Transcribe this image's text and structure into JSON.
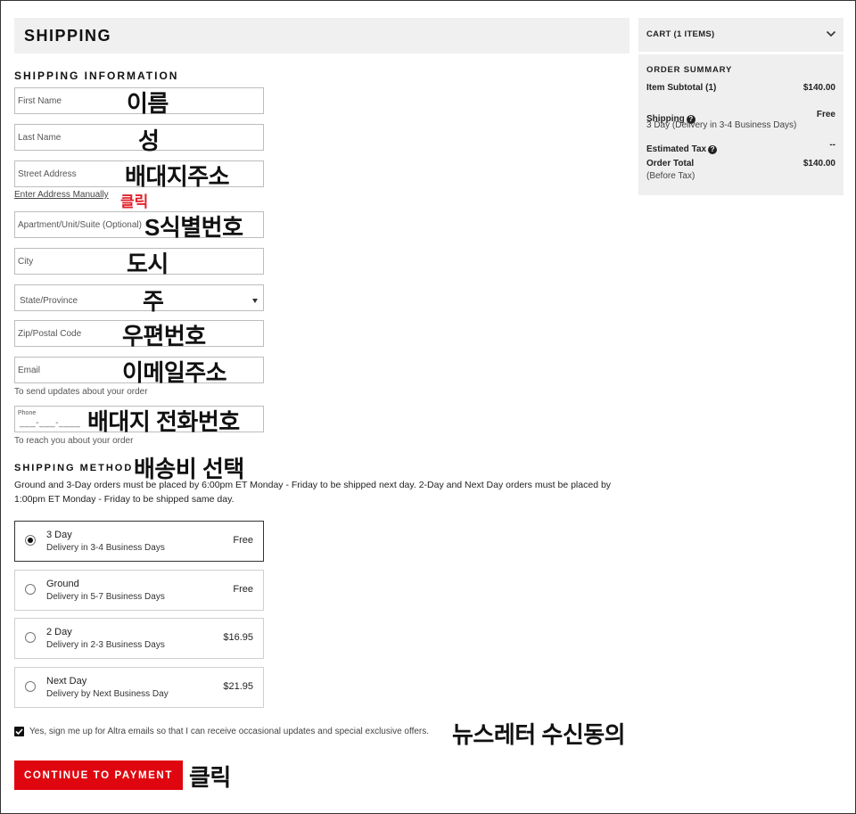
{
  "header": {
    "title": "SHIPPING"
  },
  "shipping_info": {
    "title": "SHIPPING INFORMATION",
    "fields": {
      "first_name": "First Name",
      "last_name": "Last Name",
      "street": "Street Address",
      "manual_link": "Enter Address Manually",
      "apartment": "Apartment/Unit/Suite (Optional)",
      "city": "City",
      "state": "State/Province",
      "zip": "Zip/Postal Code",
      "email": "Email",
      "email_helper": "To send updates about your order",
      "phone_label": "Phone",
      "phone_mask": "___-___-____",
      "phone_helper": "To reach you about your order"
    }
  },
  "annotations": {
    "first_name": "이름",
    "last_name": "성",
    "street": "배대지주소",
    "manual_click": "클릭",
    "apartment": "S식별번호",
    "city": "도시",
    "state": "주",
    "zip": "우편번호",
    "email": "이메일주소",
    "phone": "배대지 전화번호",
    "method": "배송비 선택",
    "newsletter": "뉴스레터 수신동의",
    "continue_click": "클릭"
  },
  "shipping_method": {
    "title": "SHIPPING METHOD",
    "note": "Ground and 3-Day orders must be placed by 6:00pm ET Monday - Friday to be shipped next day. 2-Day and Next Day orders must be placed by 1:00pm ET Monday - Friday to be shipped same day.",
    "options": [
      {
        "name": "3 Day",
        "desc": "Delivery in 3-4 Business Days",
        "price": "Free"
      },
      {
        "name": "Ground",
        "desc": "Delivery in 5-7 Business Days",
        "price": "Free"
      },
      {
        "name": "2 Day",
        "desc": "Delivery in 2-3 Business Days",
        "price": "$16.95"
      },
      {
        "name": "Next Day",
        "desc": "Delivery by Next Business Day",
        "price": "$21.95"
      }
    ]
  },
  "signup": {
    "label": "Yes, sign me up for Altra emails so that I can receive occasional updates and special exclusive offers."
  },
  "continue_label": "CONTINUE TO PAYMENT",
  "cart": {
    "title": "CART (1 ITEMS)",
    "summary_title": "ORDER SUMMARY",
    "item_subtotal_label": "Item Subtotal (1)",
    "item_subtotal_value": "$140.00",
    "shipping_label": "Shipping",
    "shipping_value": "Free",
    "shipping_sub": "3 Day (Delivery in 3-4 Business Days)",
    "tax_label": "Estimated Tax",
    "tax_value": "--",
    "total_label": "Order Total",
    "total_sub": "(Before Tax)",
    "total_value": "$140.00"
  },
  "colors": {
    "accent": "#e0060f",
    "annotation_red": "#e0232b",
    "panel_bg": "#efefef"
  }
}
